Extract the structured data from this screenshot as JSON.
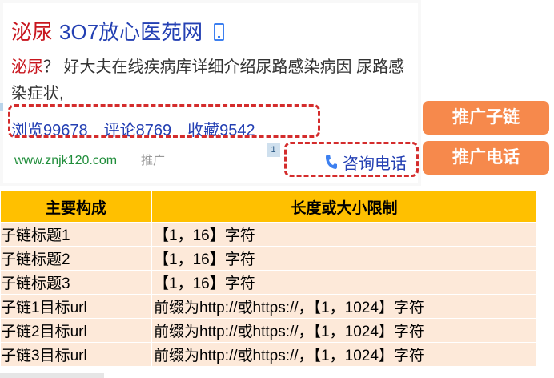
{
  "ad": {
    "title_keyword": "泌尿",
    "title_rest": "3O7放心医苑网",
    "title_icon": "mobile-phone-icon",
    "desc_keyword": "泌尿",
    "desc_rest": "？ 好大夫在线疾病库详细介绍尿路感染病因 尿路感染症状,",
    "sublinks": [
      {
        "label": "浏览99678"
      },
      {
        "label": "评论8769"
      },
      {
        "label": "收藏9542"
      }
    ],
    "url": "www.znjk120.com",
    "tag": "推广",
    "badge": "1",
    "call_label": "咨询电话",
    "call_icon": "telephone-icon",
    "link_color": "#2440b3",
    "keyword_color": "#c8161e",
    "url_color": "#1f8d3a"
  },
  "buttons": {
    "sublink_label": "推广子链",
    "call_label": "推广电话",
    "color": "#f6894c"
  },
  "table": {
    "headers": [
      "主要构成",
      "长度或大小限制"
    ],
    "rows": [
      [
        "子链标题1",
        "【1，16】字符"
      ],
      [
        "子链标题2",
        "【1，16】字符"
      ],
      [
        "子链标题3",
        "【1，16】字符"
      ],
      [
        "子链1目标url",
        "前缀为http://或https://，【1，1024】字符"
      ],
      [
        "子链2目标url",
        "前缀为http://或https://，【1，1024】字符"
      ],
      [
        "子链3目标url",
        "前缀为http://或https://，【1，1024】字符"
      ]
    ],
    "header_color": "#ffc000",
    "row_color": "#fde9d9"
  }
}
